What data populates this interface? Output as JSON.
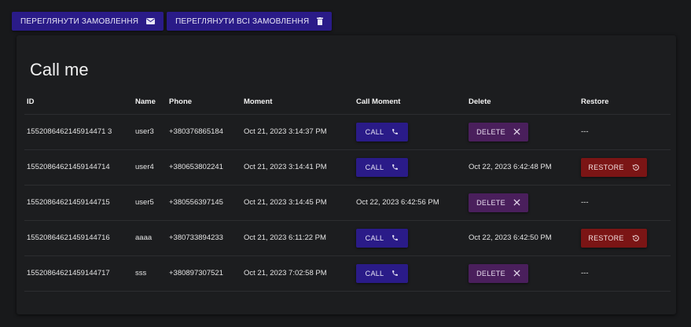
{
  "topbar": {
    "view_orders_label": "ПЕРЕГЛЯНУТИ ЗАМОВЛЕННЯ",
    "view_all_orders_label": "ПЕРЕГЛЯНУТИ ВСІ ЗАМОВЛЕННЯ"
  },
  "card": {
    "title": "Call me"
  },
  "table": {
    "headers": [
      "ID",
      "Name",
      "Phone",
      "Moment",
      "Call Moment",
      "Delete",
      "Restore"
    ],
    "call_label": "CALL",
    "delete_label": "DELETE",
    "restore_label": "RESTORE",
    "rows": [
      {
        "id": "1552086462145914471 3",
        "name": "user3",
        "phone": "+380376865184",
        "moment": "Oct 21, 2023 3:14:37 PM",
        "call_moment": "",
        "delete": "",
        "restore": "---"
      },
      {
        "id": "15520864621459144714",
        "name": "user4",
        "phone": "+380653802241",
        "moment": "Oct 21, 2023 3:14:41 PM",
        "call_moment": "",
        "delete": "Oct 22, 2023 6:42:48 PM",
        "restore": ""
      },
      {
        "id": "15520864621459144715",
        "name": "user5",
        "phone": "+380556397145",
        "moment": "Oct 21, 2023 3:14:45 PM",
        "call_moment": "Oct 22, 2023 6:42:56 PM",
        "delete": "",
        "restore": "---"
      },
      {
        "id": "15520864621459144716",
        "name": "aaaa",
        "phone": "+380733894233",
        "moment": "Oct 21, 2023 6:11:22 PM",
        "call_moment": "",
        "delete": "Oct 22, 2023 6:42:50 PM",
        "restore": ""
      },
      {
        "id": "15520864621459144717",
        "name": "sss",
        "phone": "+380897307521",
        "moment": "Oct 21, 2023 7:02:58 PM",
        "call_moment": "",
        "delete": "",
        "restore": "---"
      }
    ]
  },
  "colors": {
    "primary": "#2a1b88",
    "delete": "#4a1f5c",
    "restore": "#7b1515",
    "background": "#18191b"
  },
  "icons": {
    "view_orders": "envelope-icon",
    "view_all_orders": "trash-icon",
    "call": "phone-icon",
    "delete": "close-icon",
    "restore": "restore-icon"
  }
}
